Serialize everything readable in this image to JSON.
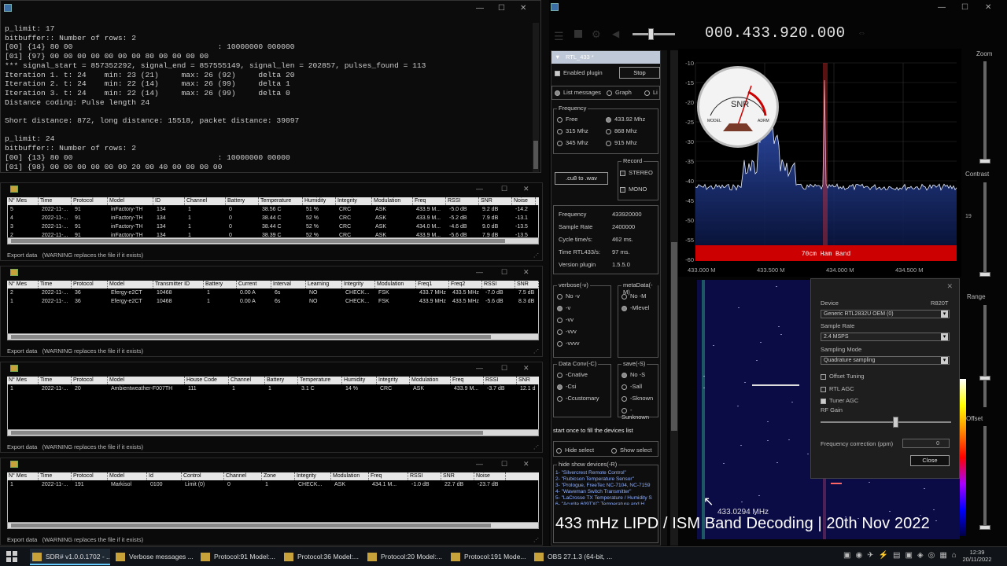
{
  "console": {
    "lines": "p_limit: 17\nbitbuffer:: Number of rows: 2\n[00] {14} 80 00                                : 10000000 000000\n[01] {97} 00 00 00 00 00 00 00 80 00 00 00 00\n*** signal_start = 857352292, signal_end = 857555149, signal_len = 202857, pulses_found = 113\nIteration 1. t: 24    min: 23 (21)     max: 26 (92)     delta 20\nIteration 2. t: 24    min: 22 (14)     max: 26 (99)     delta 1\nIteration 3. t: 24    min: 22 (14)     max: 26 (99)     delta 0\nDistance coding: Pulse length 24\n\nShort distance: 872, long distance: 15518, packet distance: 39097\n\np_limit: 24\nbitbuffer:: Number of rows: 2\n[00] {13} 80 00                                : 10000000 00000\n[01] {98} 00 00 00 00 00 00 20 00 40 00 00 00 00"
  },
  "export_label": "Export data",
  "warning_label": "(WARNING replaces the file if it exists)",
  "windows": [
    {
      "headers": [
        "N° Mes",
        "Time",
        "Protocol",
        "Model",
        "ID",
        "Channel",
        "Battery",
        "Temperature",
        "Humidity",
        "Integrity",
        "Modulation",
        "Freq",
        "RSSI",
        "SNR",
        "Noise"
      ],
      "rows": [
        [
          "5",
          "2022-11-...",
          "91",
          "inFactory-TH",
          "134",
          "1",
          "0",
          "38.56 C",
          "51 %",
          "CRC",
          "ASK",
          "433.9 M...",
          "-5.0 dB",
          "9.2 dB",
          "-14.2"
        ],
        [
          "4",
          "2022-11-...",
          "91",
          "inFactory-TH",
          "134",
          "1",
          "0",
          "38.44 C",
          "52 %",
          "CRC",
          "ASK",
          "433.9 M...",
          "-5.2 dB",
          "7.9 dB",
          "-13.1"
        ],
        [
          "3",
          "2022-11-...",
          "91",
          "inFactory-TH",
          "134",
          "1",
          "0",
          "38.44 C",
          "52 %",
          "CRC",
          "ASK",
          "434.0 M...",
          "-4.6 dB",
          "9.0 dB",
          "-13.5"
        ],
        [
          "2",
          "2022-11-...",
          "91",
          "inFactory-TH",
          "134",
          "1",
          "0",
          "38.39 C",
          "52 %",
          "CRC",
          "ASK",
          "433.9 M...",
          "-5.6 dB",
          "7.9 dB",
          "-13.5"
        ]
      ]
    },
    {
      "headers": [
        "N° Mes",
        "Time",
        "Protocol",
        "Model",
        "Transmitter ID",
        "Battery",
        "Current",
        "Interval",
        "Learning",
        "Integrity",
        "Modulation",
        "Freq1",
        "Freq2",
        "RSSI",
        "SNR"
      ],
      "rows": [
        [
          "2",
          "2022-11-...",
          "36",
          "Efergy-e2CT",
          "10468",
          "1",
          "0.00 A",
          "6s",
          "NO",
          "CHECK...",
          "FSK",
          "433.7 MHz",
          "433.5 MHz",
          "-7.0 dB",
          "7.5 dB"
        ],
        [
          "1",
          "2022-11-...",
          "36",
          "Efergy-e2CT",
          "10468",
          "1",
          "0.00 A",
          "6s",
          "NO",
          "CHECK...",
          "FSK",
          "433.9 MHz",
          "433.5 MHz",
          "-5.6 dB",
          "8.3 dB"
        ]
      ]
    },
    {
      "headers": [
        "N° Mes",
        "Time",
        "Protocol",
        "Model",
        "House Code",
        "Channel",
        "Battery",
        "Temperature",
        "Humidity",
        "Integrity",
        "Modulation",
        "Freq",
        "RSSI",
        "SNR"
      ],
      "rows": [
        [
          "1",
          "2022-11-...",
          "20",
          "Ambientweather-F007TH",
          "111",
          "1",
          "1",
          "3.1 C",
          "14 %",
          "CRC",
          "ASK",
          "433.9 M...",
          "-3.7 dB",
          "12.1 d"
        ]
      ]
    },
    {
      "headers": [
        "N° Mes",
        "Time",
        "Protocol",
        "Model",
        "Id",
        "Control",
        "Channel",
        "Zone",
        "Integrity",
        "Modulation",
        "Freq",
        "RSSI",
        "SNR",
        "Noise"
      ],
      "rows": [
        [
          "1",
          "2022-11-...",
          "191",
          "Markisol",
          "0100",
          "Limit (0)",
          "0",
          "1",
          "CHECK...",
          "ASK",
          "434.1 M...",
          "-1.0 dB",
          "22.7 dB",
          "-23.7 dB"
        ]
      ]
    }
  ],
  "sdr": {
    "frequency_display": "000.433.920.000",
    "plugin_title": "RTL_433 *",
    "enabled_plugin": "Enabled plugin",
    "stop": "Stop",
    "list_messages": "List messages",
    "graph": "Graph",
    "list_cut": "Li",
    "frequency_group": "Frequency",
    "freq_options": [
      "Free",
      "433.92 Mhz",
      "315 Mhz",
      "868 Mhz",
      "345 Mhz",
      "915 Mhz"
    ],
    "record_group": "Record",
    "stereo": "STEREO",
    "mono": "MONO",
    "cu8_button": ".cu8 to .wav",
    "info": [
      [
        "Frequency",
        "433920000"
      ],
      [
        "Sample Rate",
        "2400000"
      ],
      [
        "Cycle time/s:",
        "462 ms."
      ],
      [
        "Time RTL433/s:",
        "97 ms."
      ],
      [
        "Version plugin",
        "1.5.5.0"
      ]
    ],
    "verbose_group": "verbose(-v)",
    "verbose_opts": [
      "No -v",
      "-v",
      "-vv",
      "-vvv",
      "-vvvv"
    ],
    "meta_group": "metaData(-M)",
    "meta_opts": [
      "No -M",
      "-Mlevel"
    ],
    "dataconv_group": "Data Conv(-C)",
    "dataconv_opts": [
      "-Cnative",
      "-Csi",
      "-Ccustomary"
    ],
    "save_group": "save(-S)",
    "save_opts": [
      "No -S",
      "-Sall",
      "-Sknown",
      "-Sunknown"
    ],
    "start_once": "start once to fill  the devices list",
    "hide_select": "Hide select",
    "show_select": "Show select",
    "hide_show_group": "hide show devices(-R)",
    "devices": [
      "1- \"Silvercrest Remote Control\"",
      "2- \"Rubicson Temperature Sensor\"",
      "3- \"Prologue, FreeTec NC-7104, NC-7159",
      "4- \"Waveman Switch Transmitter\"",
      "5- \"LaCrosse TX Temperature / Humidity S",
      "6- \"Acurite 609TXC Temperature and H"
    ],
    "snr_label": "SNR",
    "meter_model": "MODEL",
    "meter_brand": "ADRM",
    "db_ticks": [
      "-10",
      "-15",
      "-20",
      "-25",
      "-30",
      "-35",
      "-40",
      "-45",
      "-50",
      "-55",
      "-60"
    ],
    "freq_ticks": [
      "433.000 M",
      "433.500 M",
      "434.000 M",
      "434.500 M"
    ],
    "band_label": "70cm Ham Band",
    "marker_value": "19",
    "waterfall_freq": "433.0294 MHz",
    "device_panel": {
      "device_label": "Device",
      "device_type": "R820T",
      "device_value": "Generic RTL2832U OEM (0)",
      "sample_rate_label": "Sample Rate",
      "sample_rate_value": "2.4 MSPS",
      "sampling_mode_label": "Sampling Mode",
      "sampling_mode_value": "Quadrature sampling",
      "offset_tuning": "Offset Tuning",
      "rtl_agc": "RTL AGC",
      "tuner_agc": "Tuner AGC",
      "rf_gain": "RF Gain",
      "freq_correction": "Frequency correction (ppm)",
      "freq_correction_value": "0",
      "close": "Close"
    },
    "sidebar": [
      "Zoom",
      "Contrast",
      "Range",
      "Offset"
    ]
  },
  "taskbar": {
    "items": [
      "SDR# v1.0.0.1702 - ...",
      "Verbose messages ...",
      "Protocol:91 Model:...",
      "Protocol:36 Model:...",
      "Protocol:20 Model:...",
      "Protocol:191 Mode...",
      "OBS 27.1.3 (64-bit, ..."
    ],
    "time": "12:39",
    "date": "20/11/2022"
  },
  "caption": "433 mHz LIPD / ISM Band Decoding | 20th Nov 2022",
  "colors": {
    "band_red": "#cc0000",
    "accent": "#3a6ea5",
    "spectrum_blue": "#1e3a8a"
  }
}
